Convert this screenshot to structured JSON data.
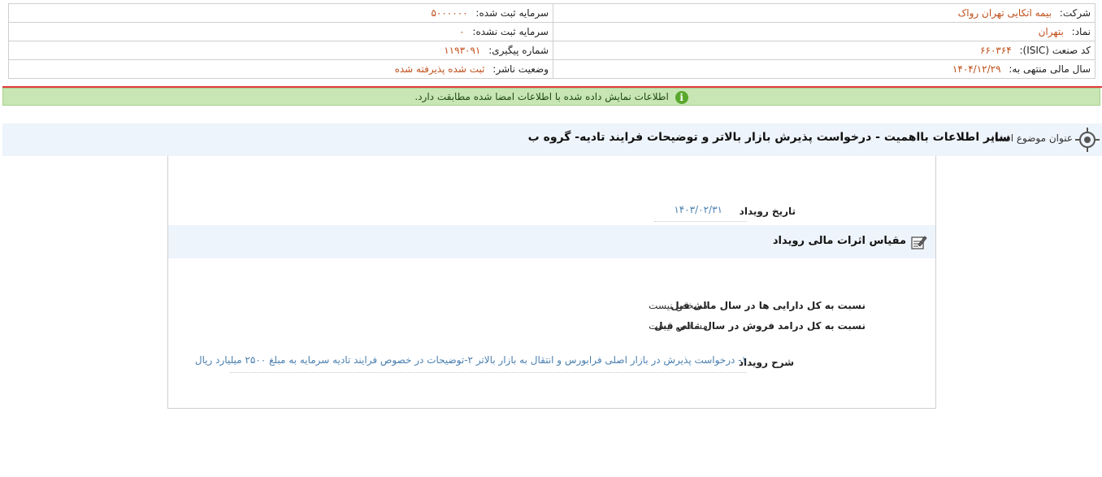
{
  "company_info": {
    "company_label": "شرکت:",
    "company_value": "بیمه اتکایی تهران رواک",
    "registered_capital_label": "سرمایه ثبت شده:",
    "registered_capital_value": "۵۰۰۰۰۰۰",
    "symbol_label": "نماد:",
    "symbol_value": "بتهران",
    "unregistered_capital_label": "سرمایه ثبت نشده:",
    "unregistered_capital_value": "۰",
    "isic_label": "کد صنعت (ISIC):",
    "isic_value": "۶۶۰۳۶۴",
    "tracking_label": "شماره پیگیری:",
    "tracking_value": "۱۱۹۳۰۹۱",
    "fiscal_year_label": "سال مالی منتهی به:",
    "fiscal_year_value": "۱۴۰۴/۱۲/۲۹",
    "publisher_status_label": "وضعیت ناشر:",
    "publisher_status_value": "ثبت شده پذیرفته شده"
  },
  "notice": {
    "text": "اطلاعات نمایش داده شده با اطلاعات امضا شده مطابقت دارد.",
    "icon": "info-icon",
    "icon_glyph": "i",
    "color": "#c8e6b4"
  },
  "topic": {
    "label": "عنوان موضوع افشا:",
    "title": "سایر اطلاعات بااهمیت - درخواست پذیرش بازار بالاتر و توضیحات فرایند تادیه- گروه ب",
    "icon": "target-icon"
  },
  "event": {
    "date_label": "تاریخ رویداد",
    "date_value": "۱۴۰۳/۰۲/۳۱",
    "section_title": "مقیاس اثرات مالی رویداد",
    "section_icon": "edit-note-icon",
    "ratio_assets_label": "نسبت به کل دارایی ها در سال مالی قبل",
    "ratio_assets_value": "مشخص نیست",
    "ratio_revenue_label": "نسبت به کل درامد فروش در سال مالی قبل",
    "ratio_revenue_value": "مشخص نیست",
    "description_label": "شرح رویداد",
    "description_value": "۱- درخواست پذیرش در بازار اصلی فرابورس و انتقال به بازار بالاتر ۲-توضیحات در خصوص فرایند تادیه سرمایه به مبلغ ۲۵۰۰ میلیارد ریال"
  },
  "colors": {
    "accent_value": "#c0501c",
    "link_value": "#4a7fb0",
    "divider_red": "#e23b3b"
  }
}
